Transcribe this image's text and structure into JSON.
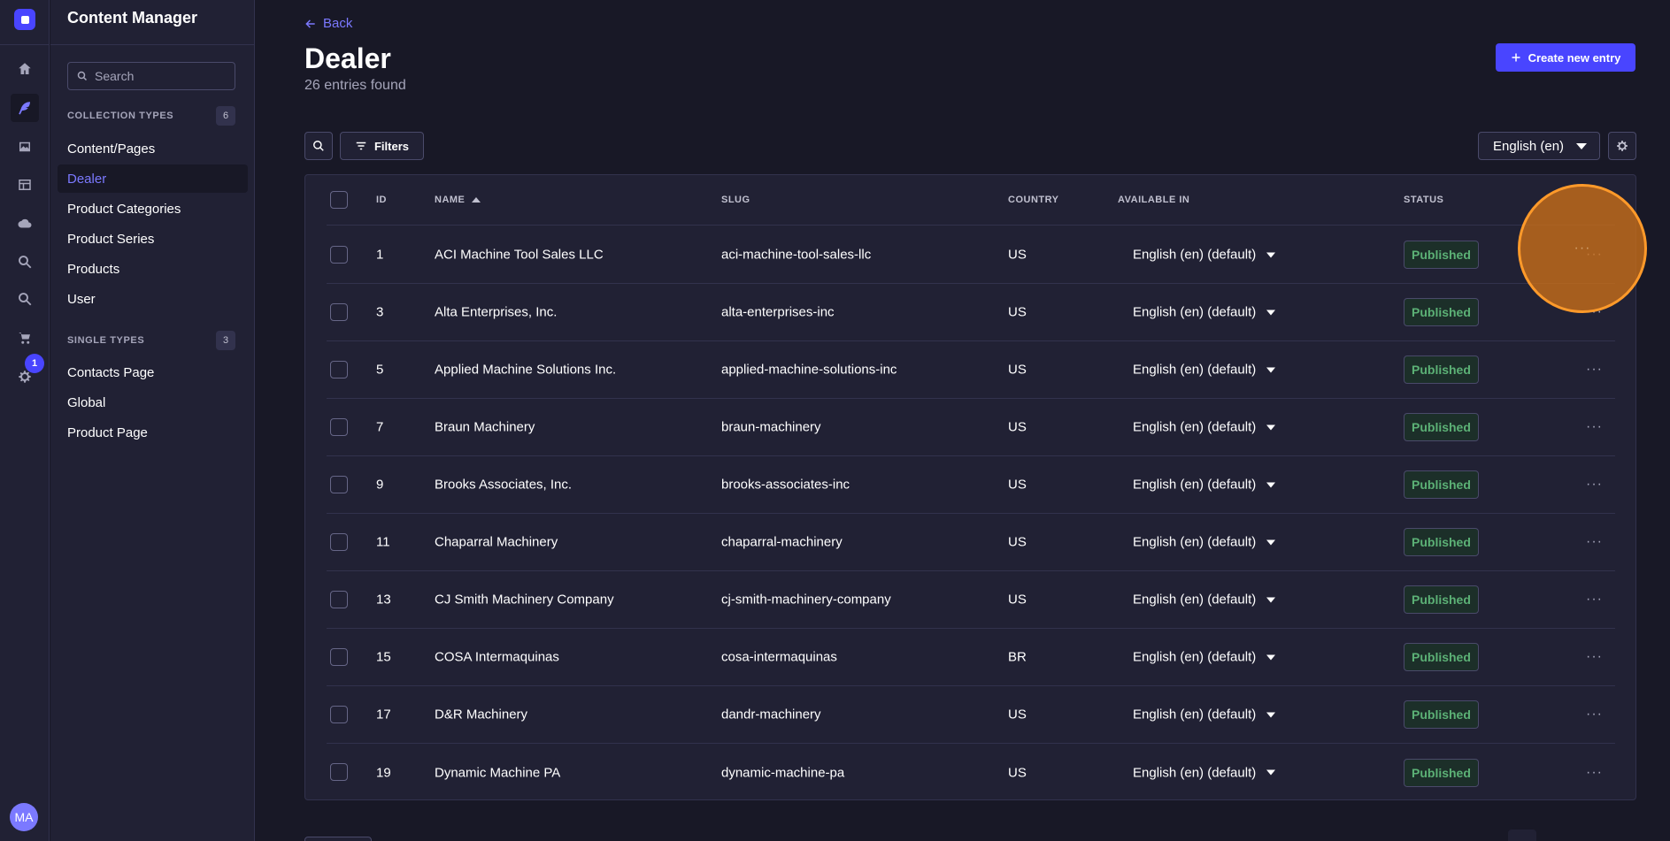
{
  "app": {
    "title": "Content Manager",
    "avatar_initials": "MA",
    "notification_count": "1"
  },
  "rail": {
    "items": [
      {
        "icon": "home-icon"
      },
      {
        "icon": "feather-icon"
      },
      {
        "icon": "images-icon"
      },
      {
        "icon": "layout-icon"
      },
      {
        "icon": "cloud-icon"
      },
      {
        "icon": "search-icon"
      },
      {
        "icon": "search-icon"
      },
      {
        "icon": "cart-icon"
      },
      {
        "icon": "gear-icon"
      }
    ]
  },
  "sidebar": {
    "search_placeholder": "Search",
    "collection_label": "COLLECTION TYPES",
    "collection_count": "6",
    "collection_items": [
      "Content/Pages",
      "Dealer",
      "Product Categories",
      "Product Series",
      "Products",
      "User"
    ],
    "single_label": "SINGLE TYPES",
    "single_count": "3",
    "single_items": [
      "Contacts Page",
      "Global",
      "Product Page"
    ]
  },
  "header": {
    "back_label": "Back",
    "title": "Dealer",
    "subtitle": "26 entries found",
    "create_label": "Create new entry"
  },
  "toolbar": {
    "filters_label": "Filters",
    "locale": "English (en)"
  },
  "table": {
    "columns": {
      "id": "ID",
      "name": "NAME",
      "slug": "SLUG",
      "country": "COUNTRY",
      "available": "AVAILABLE IN",
      "status": "STATUS"
    },
    "rows": [
      {
        "id": "1",
        "name": "ACI Machine Tool Sales LLC",
        "slug": "aci-machine-tool-sales-llc",
        "country": "US",
        "available": "English (en) (default)",
        "status": "Published"
      },
      {
        "id": "3",
        "name": "Alta Enterprises, Inc.",
        "slug": "alta-enterprises-inc",
        "country": "US",
        "available": "English (en) (default)",
        "status": "Published"
      },
      {
        "id": "5",
        "name": "Applied Machine Solutions Inc.",
        "slug": "applied-machine-solutions-inc",
        "country": "US",
        "available": "English (en) (default)",
        "status": "Published"
      },
      {
        "id": "7",
        "name": "Braun Machinery",
        "slug": "braun-machinery",
        "country": "US",
        "available": "English (en) (default)",
        "status": "Published"
      },
      {
        "id": "9",
        "name": "Brooks Associates, Inc.",
        "slug": "brooks-associates-inc",
        "country": "US",
        "available": "English (en) (default)",
        "status": "Published"
      },
      {
        "id": "11",
        "name": "Chaparral Machinery",
        "slug": "chaparral-machinery",
        "country": "US",
        "available": "English (en) (default)",
        "status": "Published"
      },
      {
        "id": "13",
        "name": "CJ Smith Machinery Company",
        "slug": "cj-smith-machinery-company",
        "country": "US",
        "available": "English (en) (default)",
        "status": "Published"
      },
      {
        "id": "15",
        "name": "COSA Intermaquinas",
        "slug": "cosa-intermaquinas",
        "country": "BR",
        "available": "English (en) (default)",
        "status": "Published"
      },
      {
        "id": "17",
        "name": "D&R Machinery",
        "slug": "dandr-machinery",
        "country": "US",
        "available": "English (en) (default)",
        "status": "Published"
      },
      {
        "id": "19",
        "name": "Dynamic Machine PA",
        "slug": "dynamic-machine-pa",
        "country": "US",
        "available": "English (en) (default)",
        "status": "Published"
      }
    ]
  },
  "colors": {
    "accent": "#4945ff",
    "accent_text": "#7b79ff",
    "success": "#5cb176",
    "background": "#181826",
    "surface": "#212134"
  }
}
